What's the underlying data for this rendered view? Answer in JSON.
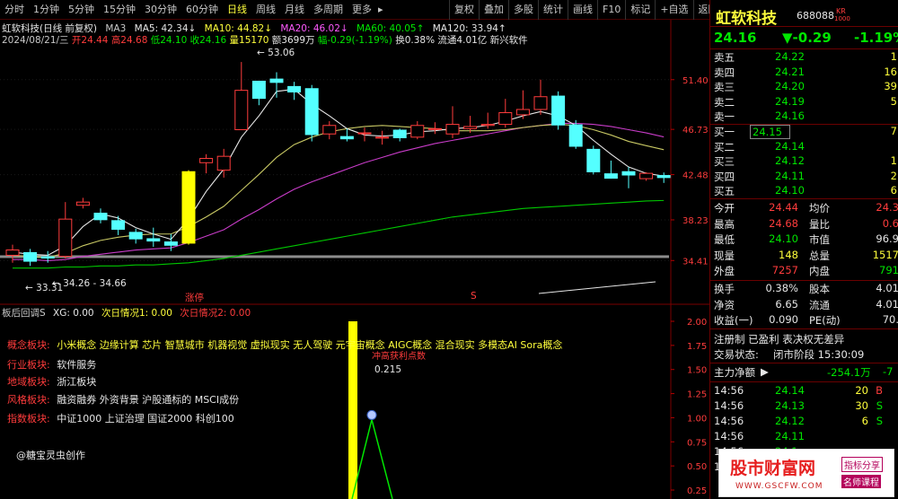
{
  "toolbar": {
    "periods": [
      "分时",
      "1分钟",
      "5分钟",
      "15分钟",
      "30分钟",
      "60分钟",
      "日线",
      "周线",
      "月线",
      "多周期",
      "更多"
    ],
    "active_period": "日线",
    "more_arrow": "▸",
    "right_buttons": [
      "复权",
      "叠加",
      "多股",
      "统计",
      "画线",
      "F10",
      "标记",
      "+自选",
      "返回"
    ]
  },
  "chart_header": {
    "title": "虹软科技(日线 前复权)",
    "ma3": "MA3",
    "ma5": "MA5: 42.34↓",
    "ma10": "MA10: 44.82↓",
    "ma20": "MA20: 46.02↓",
    "ma60": "MA60: 40.05↑",
    "ma120": "MA120: 33.94↑",
    "info_date": "2024/08/21/三",
    "info_open": "开24.44",
    "info_high": "高24.68",
    "info_low": "低24.10",
    "info_close": "收24.16",
    "info_vol": "量15170",
    "info_amt": "额3699万",
    "info_chg": "幅-0.29(-1.19%)",
    "info_turn": "换0.38%",
    "info_float": "流通4.01亿",
    "info_industry": "新兴软件"
  },
  "price_axis": [
    "51.40",
    "46.73",
    "42.48",
    "38.23",
    "34.41"
  ],
  "annotations": {
    "high": "53.06",
    "low_left": "33.31",
    "range": "34.26 - 34.66",
    "marker_zhangting": "涨停",
    "marker_s": "S"
  },
  "indicator": {
    "header_name": "板后回调S",
    "header_xg": "XG: 0.00",
    "header_c1": "次日情况1: 0.00",
    "header_c2": "次日情况2: 0.00",
    "axis": [
      "2.00",
      "1.75",
      "1.50",
      "1.25",
      "1.00",
      "0.75",
      "0.50",
      "0.25"
    ],
    "peak_label": "冲高获利点数",
    "peak_value": "0.215",
    "concept_label": "概念板块:",
    "concept_value": "小米概念 边缘计算 芯片 智慧城市 机器视觉 虚拟现实 无人驾驶 元宇宙概念 AIGC概念 混合现实 多模态AI Sora概念",
    "industry_label": "行业板块:",
    "industry_value": "软件服务",
    "region_label": "地域板块:",
    "region_value": "浙江板块",
    "style_label": "风格板块:",
    "style_value": "融资融券 外资背景 沪股通标的 MSCI成份",
    "index_label": "指数板块:",
    "index_value": "中证1000 上证治理 国证2000 科创100",
    "author": "@糖宝灵虫创作"
  },
  "quote": {
    "name": "虹软科技",
    "code": "688088",
    "badge_top": "KR",
    "badge_bottom": "1000",
    "price": "24.16",
    "change": "▼-0.29",
    "change_pct": "-1.19%",
    "asks": [
      {
        "label": "卖五",
        "price": "24.22",
        "vol": "1"
      },
      {
        "label": "卖四",
        "price": "24.21",
        "vol": "16"
      },
      {
        "label": "卖三",
        "price": "24.20",
        "vol": "39"
      },
      {
        "label": "卖二",
        "price": "24.19",
        "vol": "5"
      },
      {
        "label": "卖一",
        "price": "24.16",
        "vol": ""
      }
    ],
    "bids": [
      {
        "label": "买一",
        "price": "24.15",
        "vol": "7"
      },
      {
        "label": "买二",
        "price": "24.14",
        "vol": ""
      },
      {
        "label": "买三",
        "price": "24.12",
        "vol": "1"
      },
      {
        "label": "买四",
        "price": "24.11",
        "vol": "2"
      },
      {
        "label": "买五",
        "price": "24.10",
        "vol": "6"
      }
    ],
    "stats": [
      {
        "l1": "今开",
        "v1": "24.44",
        "l2": "均价",
        "v2": "24.3"
      },
      {
        "l1": "最高",
        "v1": "24.68",
        "l2": "量比",
        "v2": "0.6"
      },
      {
        "l1": "最低",
        "v1": "24.10",
        "l2": "市值",
        "v2": "96.9"
      },
      {
        "l1": "现量",
        "v1": "148",
        "l2": "总量",
        "v2": "1517"
      },
      {
        "l1": "外盘",
        "v1": "7257",
        "l2": "内盘",
        "v2": "791"
      }
    ],
    "stats2": [
      {
        "l1": "换手",
        "v1": "0.38%",
        "l2": "股本",
        "v2": "4.01"
      },
      {
        "l1": "净资",
        "v1": "6.65",
        "l2": "流通",
        "v2": "4.01"
      },
      {
        "l1": "收益(一)",
        "v1": "0.090",
        "l2": "PE(动)",
        "v2": "70."
      }
    ],
    "notice": "注册制 已盈利 表决权无差异",
    "status_label": "交易状态:",
    "status_value": "闭市阶段 15:30:09",
    "flow_label": "主力净额",
    "flow_value": "-254.1万",
    "flow_pct": "-7",
    "ticks": [
      {
        "time": "14:56",
        "price": "24.14",
        "vol": "20",
        "dir": "B"
      },
      {
        "time": "14:56",
        "price": "24.13",
        "vol": "30",
        "dir": "S"
      },
      {
        "time": "14:56",
        "price": "24.12",
        "vol": "6",
        "dir": "S"
      },
      {
        "time": "14:56",
        "price": "24.11",
        "vol": "",
        "dir": ""
      },
      {
        "time": "14:56",
        "price": "24.1",
        "vol": "",
        "dir": ""
      },
      {
        "time": "14:56",
        "price": "24.1",
        "vol": "",
        "dir": ""
      }
    ]
  },
  "ad": {
    "title": "股市财富网",
    "url": "WWW.GSCFW.COM",
    "tag1": "指标分享",
    "tag2": "名师课程"
  },
  "chart_data": {
    "type": "candlestick",
    "ylim": [
      33.0,
      54.5
    ],
    "candles": [
      {
        "o": 34.9,
        "c": 35.4,
        "h": 35.9,
        "l": 34.2
      },
      {
        "o": 35.2,
        "c": 34.3,
        "h": 35.5,
        "l": 33.9
      },
      {
        "o": 34.8,
        "c": 34.6,
        "h": 35.3,
        "l": 34.2
      },
      {
        "o": 34.8,
        "c": 38.3,
        "h": 39.9,
        "l": 34.6
      },
      {
        "o": 39.6,
        "c": 39.9,
        "h": 40.3,
        "l": 39.3
      },
      {
        "o": 38.9,
        "c": 38.2,
        "h": 39.3,
        "l": 37.9
      },
      {
        "o": 38.2,
        "c": 37.3,
        "h": 38.6,
        "l": 36.8
      },
      {
        "o": 37.1,
        "c": 36.4,
        "h": 37.4,
        "l": 36.0
      },
      {
        "o": 36.5,
        "c": 36.2,
        "h": 37.5,
        "l": 35.7
      },
      {
        "o": 36.2,
        "c": 35.8,
        "h": 36.9,
        "l": 35.3
      },
      {
        "o": 36.0,
        "c": 42.8,
        "h": 42.9,
        "l": 35.9
      },
      {
        "o": 43.6,
        "c": 44.0,
        "h": 44.4,
        "l": 42.6
      },
      {
        "o": 42.9,
        "c": 44.2,
        "h": 44.9,
        "l": 42.2
      },
      {
        "o": 46.7,
        "c": 50.4,
        "h": 53.06,
        "l": 46.7
      },
      {
        "o": 51.3,
        "c": 49.6,
        "h": 51.3,
        "l": 49.0
      },
      {
        "o": 51.5,
        "c": 51.1,
        "h": 52.1,
        "l": 49.7
      },
      {
        "o": 50.8,
        "c": 50.2,
        "h": 51.2,
        "l": 49.5
      },
      {
        "o": 50.6,
        "c": 46.2,
        "h": 50.9,
        "l": 45.6
      },
      {
        "o": 46.3,
        "c": 47.1,
        "h": 47.5,
        "l": 45.8
      },
      {
        "o": 46.1,
        "c": 45.8,
        "h": 46.8,
        "l": 45.6
      },
      {
        "o": 46.4,
        "c": 46.4,
        "h": 46.9,
        "l": 45.6
      },
      {
        "o": 46.0,
        "c": 46.0,
        "h": 46.6,
        "l": 45.3
      },
      {
        "o": 46.7,
        "c": 45.9,
        "h": 46.8,
        "l": 45.6
      },
      {
        "o": 46.0,
        "c": 47.1,
        "h": 47.5,
        "l": 45.8
      },
      {
        "o": 46.8,
        "c": 46.8,
        "h": 47.4,
        "l": 46.3
      },
      {
        "o": 46.3,
        "c": 47.2,
        "h": 48.9,
        "l": 45.9
      },
      {
        "o": 46.8,
        "c": 47.0,
        "h": 48.0,
        "l": 46.4
      },
      {
        "o": 47.1,
        "c": 47.2,
        "h": 48.3,
        "l": 46.8
      },
      {
        "o": 47.2,
        "c": 48.3,
        "h": 49.6,
        "l": 46.9
      },
      {
        "o": 48.1,
        "c": 48.6,
        "h": 50.4,
        "l": 47.7
      },
      {
        "o": 48.6,
        "c": 49.8,
        "h": 51.4,
        "l": 48.1
      },
      {
        "o": 49.9,
        "c": 47.1,
        "h": 50.3,
        "l": 46.7
      },
      {
        "o": 47.2,
        "c": 45.1,
        "h": 47.6,
        "l": 44.9
      },
      {
        "o": 44.9,
        "c": 42.7,
        "h": 45.2,
        "l": 42.5
      },
      {
        "o": 42.6,
        "c": 42.1,
        "h": 43.8,
        "l": 42.1
      },
      {
        "o": 42.8,
        "c": 42.4,
        "h": 43.2,
        "l": 41.2
      },
      {
        "o": 42.1,
        "c": 42.6,
        "h": 42.7,
        "l": 41.9
      },
      {
        "o": 42.44,
        "c": 42.16,
        "h": 42.68,
        "l": 41.7
      }
    ],
    "ma_white": [
      35.2,
      35.0,
      34.9,
      35.8,
      37.6,
      38.8,
      38.4,
      37.5,
      36.9,
      36.4,
      38.3,
      40.9,
      43.0,
      46.0,
      48.0,
      50.3,
      50.5,
      49.1,
      48.0,
      46.8,
      46.2,
      46.1,
      46.2,
      46.5,
      46.6,
      46.8,
      46.9,
      47.1,
      47.5,
      48.0,
      48.4,
      48.0,
      47.1,
      45.7,
      44.4,
      43.2,
      42.6,
      42.34
    ],
    "ma_yellow": [
      34.9,
      34.8,
      34.7,
      35.1,
      35.8,
      36.3,
      36.6,
      36.8,
      36.9,
      36.9,
      37.6,
      38.5,
      39.5,
      41.0,
      42.5,
      44.1,
      45.3,
      46.0,
      46.5,
      46.8,
      47.0,
      47.1,
      47.0,
      46.9,
      46.8,
      46.6,
      46.6,
      46.6,
      46.7,
      46.9,
      47.1,
      47.2,
      47.1,
      46.7,
      46.2,
      45.6,
      45.2,
      44.82
    ],
    "ma_purple": [
      34.5,
      34.5,
      34.4,
      34.5,
      34.8,
      35.0,
      35.2,
      35.4,
      35.5,
      35.6,
      36.1,
      36.7,
      37.3,
      38.3,
      39.2,
      40.2,
      41.1,
      41.8,
      42.4,
      43.0,
      43.6,
      44.1,
      44.6,
      45.0,
      45.4,
      45.7,
      46.0,
      46.3,
      46.6,
      46.9,
      47.1,
      47.3,
      47.3,
      47.2,
      47.0,
      46.7,
      46.4,
      46.02
    ],
    "ma_green": [
      33.7,
      33.7,
      33.7,
      33.8,
      33.8,
      33.9,
      33.9,
      34.0,
      34.0,
      34.1,
      34.2,
      34.4,
      34.6,
      34.9,
      35.2,
      35.5,
      35.8,
      36.1,
      36.4,
      36.7,
      37.0,
      37.3,
      37.6,
      37.9,
      38.2,
      38.5,
      38.7,
      38.9,
      39.1,
      39.3,
      39.4,
      39.5,
      39.6,
      39.7,
      39.8,
      39.9,
      40.0,
      40.05
    ]
  }
}
